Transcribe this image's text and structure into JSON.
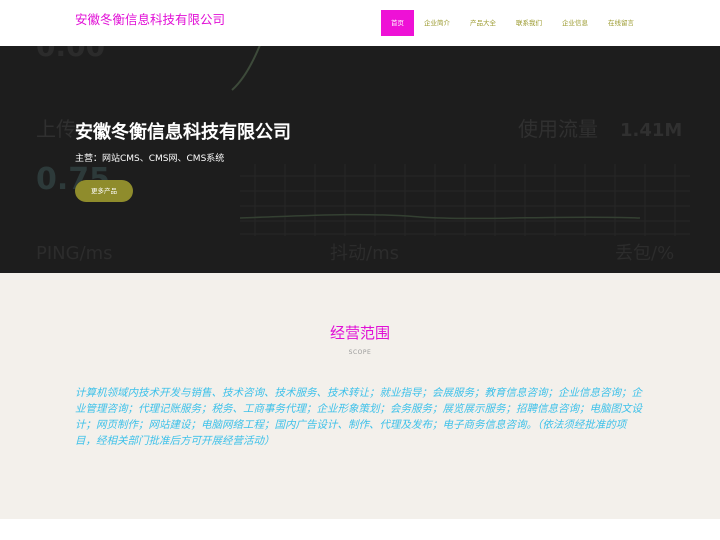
{
  "header": {
    "logo": "安徽冬衡信息科技有限公司",
    "nav": [
      {
        "label": "首页",
        "active": true
      },
      {
        "label": "企业简介",
        "active": false
      },
      {
        "label": "产品大全",
        "active": false
      },
      {
        "label": "联系我们",
        "active": false
      },
      {
        "label": "企业信息",
        "active": false
      },
      {
        "label": "在线留言",
        "active": false
      }
    ]
  },
  "hero": {
    "title": "安徽冬衡信息科技有限公司",
    "subtitle": "主营：网站CMS、CMS网、CMS系统",
    "button": "更多产品",
    "bg_labels": {
      "upload": "上传",
      "upload_value": "0.75",
      "usage": "使用流量",
      "usage_value": "1.41M",
      "ping": "PING/ms",
      "jitter": "抖动/ms",
      "loss": "丢包/%"
    }
  },
  "scope": {
    "title": "经营范围",
    "subtitle": "SCOPE",
    "text": "计算机领域内技术开发与销售、技术咨询、技术服务、技术转让；就业指导；会展服务；教育信息咨询；企业信息咨询；企业管理咨询；代理记账服务；税务、工商事务代理；企业形象策划；会务服务；展览展示服务；招聘信息咨询；电脑图文设计；网页制作；网站建设；电脑网络工程；国内广告设计、制作、代理及发布；电子商务信息咨询。（依法须经批准的项目，经相关部门批准后方可开展经营活动）"
  },
  "colors": {
    "accent": "#ee11d6",
    "nav_text": "#9b9a2e",
    "button": "#8f8c2c",
    "scope_text": "#3ec1ea",
    "hero_bg": "#1d1d1d",
    "section_bg": "#f3f0eb"
  }
}
